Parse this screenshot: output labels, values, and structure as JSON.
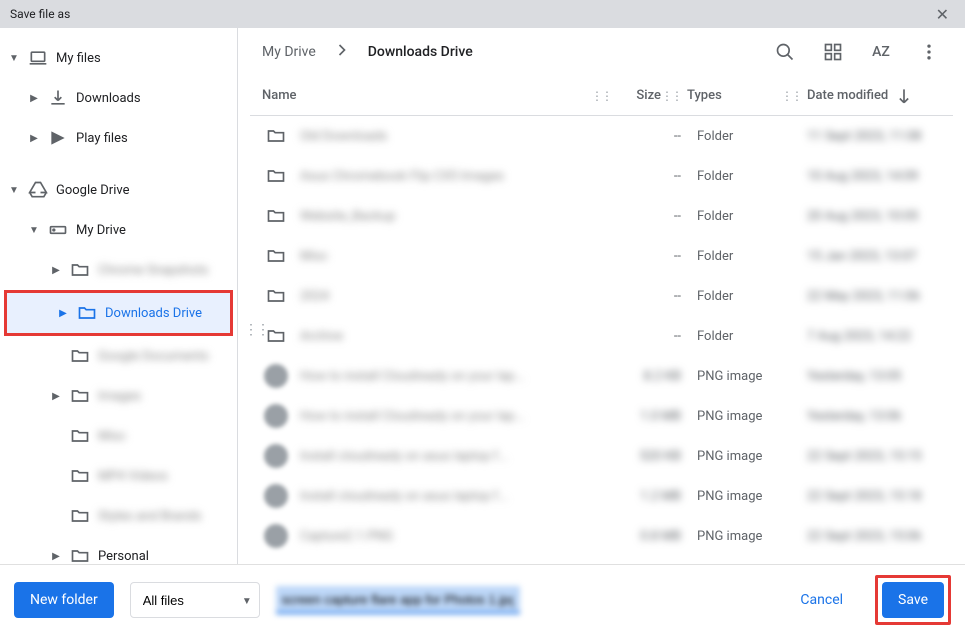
{
  "titlebar": {
    "title": "Save file as",
    "close": "✕"
  },
  "sidebar": {
    "my_files": "My files",
    "downloads": "Downloads",
    "play_files": "Play files",
    "google_drive": "Google Drive",
    "my_drive": "My Drive",
    "blurred_1": "Chrome Snapshots",
    "downloads_drive": "Downloads Drive",
    "blurred_2": "Google Documents",
    "blurred_3": "Images",
    "blurred_4": "Misc",
    "blurred_5": "MP4 Videos",
    "blurred_6": "Styles and Brands",
    "personal": "Personal"
  },
  "breadcrumb": {
    "item1": "My Drive",
    "item2": "Downloads Drive"
  },
  "header_icons": {
    "az": "AZ"
  },
  "table": {
    "headers": {
      "name": "Name",
      "size": "Size",
      "types": "Types",
      "date": "Date modified"
    },
    "rows": [
      {
        "name": "Old Downloads",
        "size": "--",
        "types": "Folder",
        "date": "11 Sept 2023, 11:08",
        "icon": "folder"
      },
      {
        "name": "Asus Chromebook Flip CX5 Images",
        "size": "--",
        "types": "Folder",
        "date": "10 Aug 2023, 14:09",
        "icon": "folder"
      },
      {
        "name": "Website_Backup",
        "size": "--",
        "types": "Folder",
        "date": "20 Aug 2023, 10:05",
        "icon": "folder"
      },
      {
        "name": "Misc",
        "size": "--",
        "types": "Folder",
        "date": "15 Jan 2023, 13:07",
        "icon": "folder"
      },
      {
        "name": "2024",
        "size": "--",
        "types": "Folder",
        "date": "22 May 2023, 11:06",
        "icon": "folder"
      },
      {
        "name": "Archive",
        "size": "--",
        "types": "Folder",
        "date": "7 Aug 2023, 14:22",
        "icon": "folder"
      },
      {
        "name": "How to install Cloudready on your lap...",
        "size": "8.2 KB",
        "types": "PNG image",
        "date": "Yesterday, 13:05",
        "icon": "thumb"
      },
      {
        "name": "How to install Cloudready on your lap...",
        "size": "1.0 MB",
        "types": "PNG image",
        "date": "Yesterday, 13:06",
        "icon": "thumb"
      },
      {
        "name": "Install cloudready on asus laptop f...",
        "size": "520 KB",
        "types": "PNG image",
        "date": "22 Sept 2023, 15:15",
        "icon": "thumb"
      },
      {
        "name": "Install cloudready on asus laptop f...",
        "size": "1.2 MB",
        "types": "PNG image",
        "date": "22 Sept 2023, 15:18",
        "icon": "thumb"
      },
      {
        "name": "Capture2.1.PNG",
        "size": "0.8 MB",
        "types": "PNG image",
        "date": "22 Sept 2023, 15:06",
        "icon": "thumb"
      }
    ]
  },
  "bottom": {
    "new_folder": "New folder",
    "filetype": "All files",
    "filename": "screen capture flare app for Photos 1.jpg",
    "cancel": "Cancel",
    "save": "Save"
  }
}
